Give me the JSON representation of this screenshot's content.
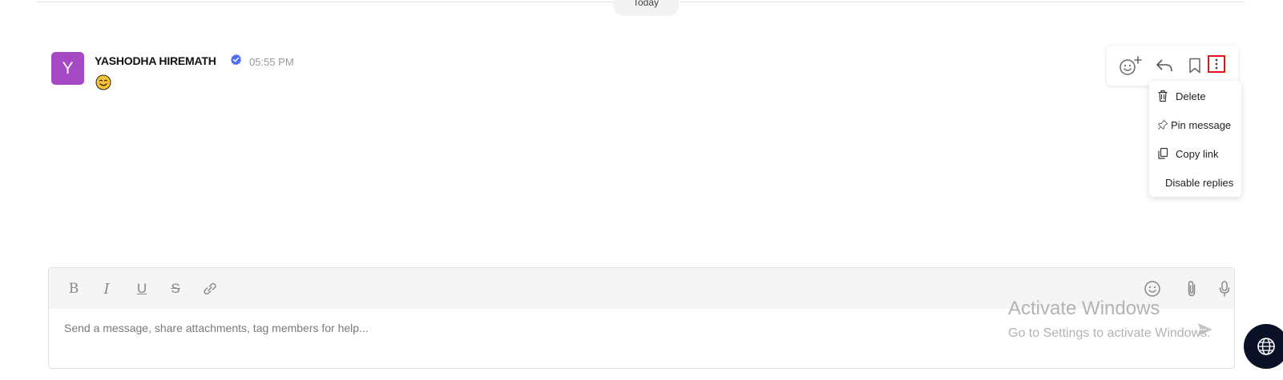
{
  "date_divider": {
    "label": "Today"
  },
  "message": {
    "avatar_initial": "Y",
    "sender": "YASHODHA HIREMATH",
    "time": "05:55 PM",
    "body_icon": "smiling-face-emoji"
  },
  "message_actions": {
    "icons": [
      "add-reaction-icon",
      "reply-icon",
      "bookmark-icon",
      "more-options-icon"
    ]
  },
  "context_menu": {
    "items": [
      {
        "label": "Delete",
        "icon": "trash-icon"
      },
      {
        "label": "Pin message",
        "icon": "pin-icon"
      },
      {
        "label": "Copy link",
        "icon": "copy-icon"
      },
      {
        "label": "Disable replies",
        "icon": ""
      }
    ]
  },
  "composer": {
    "placeholder": "Send a message, share attachments, tag members for help...",
    "format_buttons": [
      {
        "label": "B",
        "icon": "bold-icon"
      },
      {
        "label": "I",
        "icon": "italic-icon"
      },
      {
        "label": "U",
        "icon": "underline-icon"
      },
      {
        "label": "S",
        "icon": "strikethrough-icon"
      }
    ],
    "icons": [
      "link-icon",
      "emoji-icon",
      "paperclip-icon",
      "microphone-icon",
      "send-icon"
    ]
  },
  "watermark": {
    "title": "Activate Windows",
    "subtitle": "Go to Settings to activate Windows."
  },
  "colors": {
    "avatar": "#a649c4",
    "verified": "#4a6cf7",
    "highlight_border": "#e0161d",
    "chat_widget": "#0a1126"
  }
}
